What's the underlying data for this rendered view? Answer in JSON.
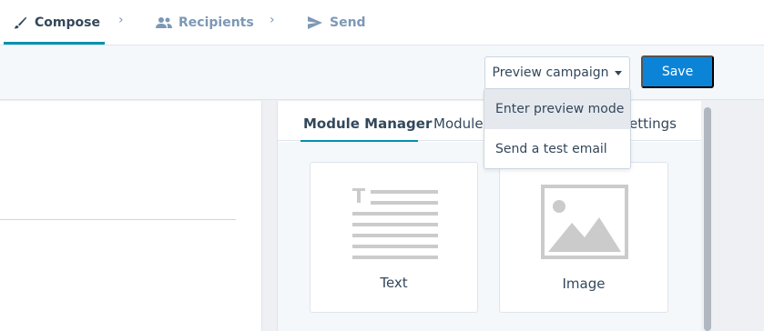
{
  "steps": {
    "compose": {
      "label": "Compose",
      "icon": "brush-icon"
    },
    "recipients": {
      "label": "Recipients",
      "icon": "people-icon"
    },
    "send": {
      "label": "Send",
      "icon": "send-icon"
    },
    "separator": "›"
  },
  "toolbar": {
    "preview_label": "Preview campaign",
    "save_label": "Save"
  },
  "preview_menu": {
    "items": [
      "Enter preview mode",
      "Send a test email"
    ]
  },
  "sidebar": {
    "tabs": [
      "Module Manager",
      "Module",
      "ettings"
    ],
    "modules": [
      {
        "label": "Text",
        "icon": "text-module-icon"
      },
      {
        "label": "Image",
        "icon": "image-module-icon"
      }
    ]
  },
  "colors": {
    "accent": "#0091ae",
    "save_button": "#0b84d8",
    "text": "#33475b",
    "muted": "#7c98b6"
  }
}
